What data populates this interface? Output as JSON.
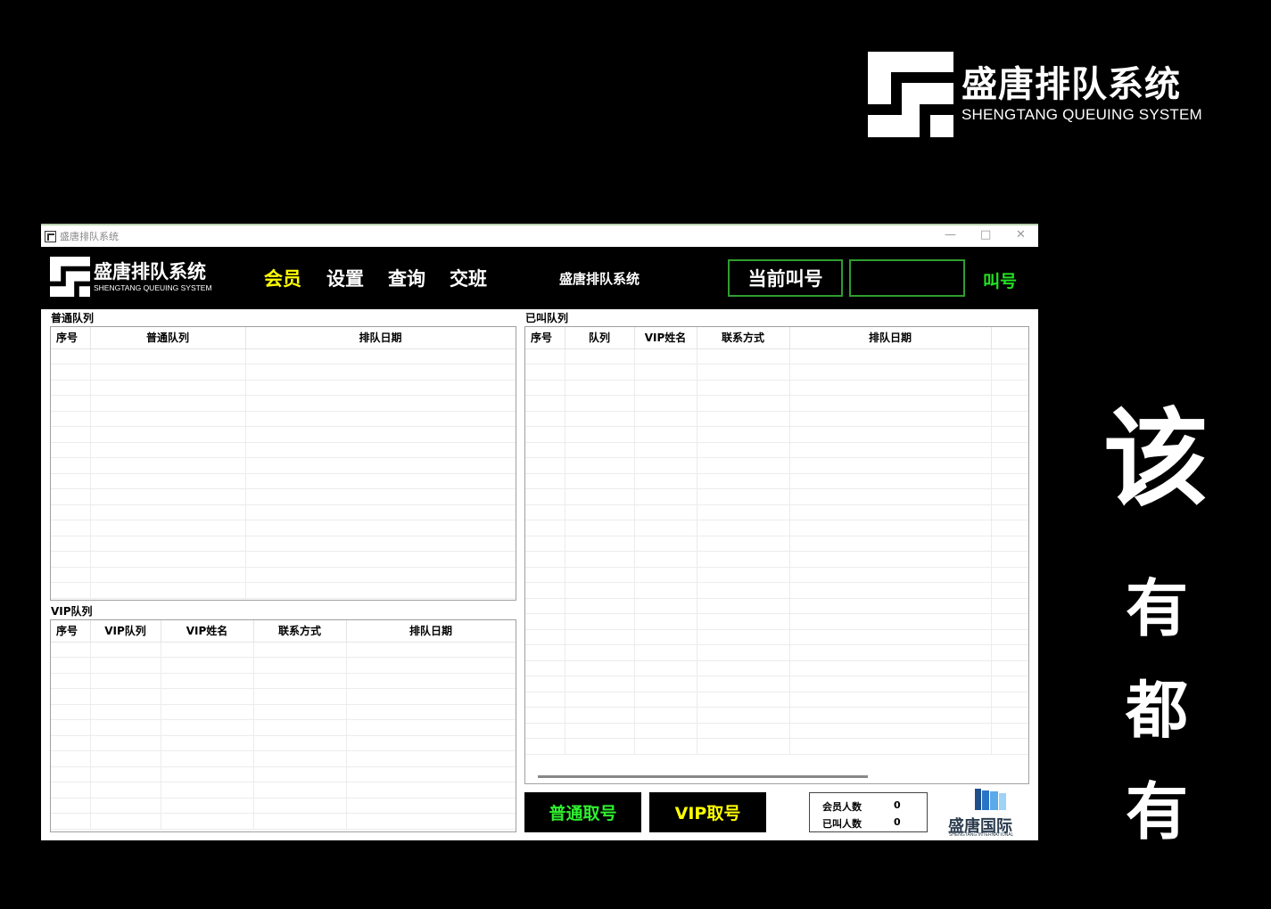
{
  "brand": {
    "name_cn": "盛唐排队系统",
    "name_en": "SHENGTANG QUEUING SYSTEM"
  },
  "slogan": {
    "first": "该",
    "rest": [
      "有",
      "都",
      "有"
    ]
  },
  "window": {
    "title": "盛唐排队系统",
    "minimize": "—",
    "maximize": "□",
    "close": "✕"
  },
  "header": {
    "logo_cn": "盛唐排队系统",
    "logo_en": "SHENGTANG QUEUING SYSTEM",
    "menu": [
      "会员",
      "设置",
      "查询",
      "交班"
    ],
    "system_title": "盛唐排队系统",
    "current_call_label": "当前叫号",
    "current_call_value": "",
    "call_button": "叫号"
  },
  "normal_queue": {
    "label": "普通队列",
    "columns": [
      "序号",
      "普通队列",
      "排队日期"
    ],
    "rows": []
  },
  "vip_queue": {
    "label": "VIP队列",
    "columns": [
      "序号",
      "VIP队列",
      "VIP姓名",
      "联系方式",
      "排队日期"
    ],
    "rows": []
  },
  "called_queue": {
    "label": "已叫队列",
    "columns": [
      "序号",
      "队列",
      "VIP姓名",
      "联系方式",
      "排队日期"
    ],
    "rows": []
  },
  "buttons": {
    "normal_ticket": "普通取号",
    "vip_ticket": "VIP取号"
  },
  "stats": {
    "members_label": "会员人数",
    "members_value": "0",
    "called_label": "已叫人数",
    "called_value": "0"
  },
  "footer_logo": {
    "cn": "盛唐国际",
    "en": "SHENGTANG INTERNATIONAL"
  },
  "colors": {
    "menu_active": "#ffff00",
    "call_green": "#22e022",
    "border_green": "#2f9d2f",
    "normal_ticket_text": "#2ef02e",
    "vip_ticket_text": "#ffff00"
  }
}
